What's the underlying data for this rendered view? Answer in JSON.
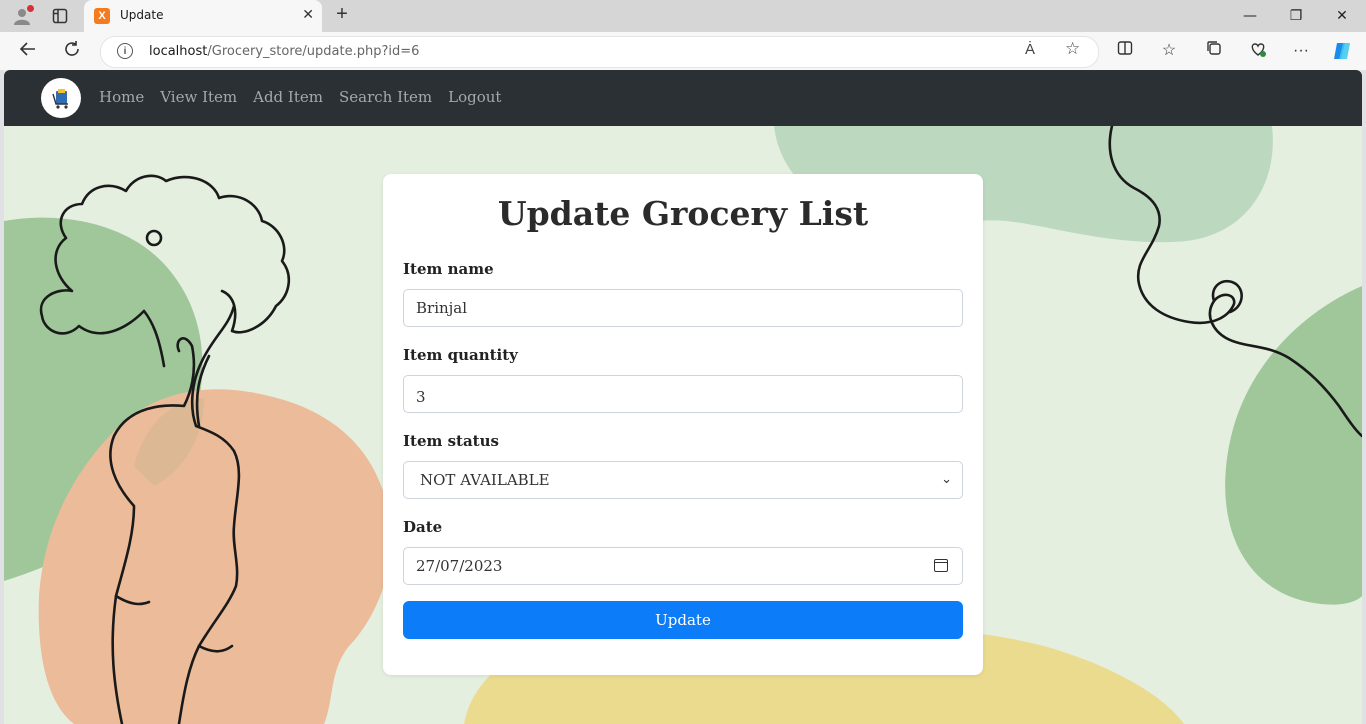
{
  "browser": {
    "tab_title": "Update",
    "tab_favicon_glyph": "X",
    "url_host": "localhost",
    "url_path": "/Grocery_store/update.php?id=6",
    "read_aloud_icon": "Ȧ"
  },
  "nav": {
    "links": [
      "Home",
      "View Item",
      "Add Item",
      "Search Item",
      "Logout"
    ]
  },
  "form": {
    "title": "Update Grocery List",
    "name_label": "Item name",
    "name_value": "Brinjal",
    "quantity_label": "Item quantity",
    "quantity_value": "3",
    "status_label": "Item status",
    "status_value": "NOT AVAILABLE",
    "date_label": "Date",
    "date_value": "27/07/2023",
    "submit_label": "Update"
  },
  "colors": {
    "navbar": "#2b3035",
    "button": "#0d7cf8",
    "page_bg": "#e4efe0",
    "blob_green": "#9fc79a",
    "blob_peach": "#ecbb9a",
    "blob_yellow": "#ebdb8e"
  }
}
